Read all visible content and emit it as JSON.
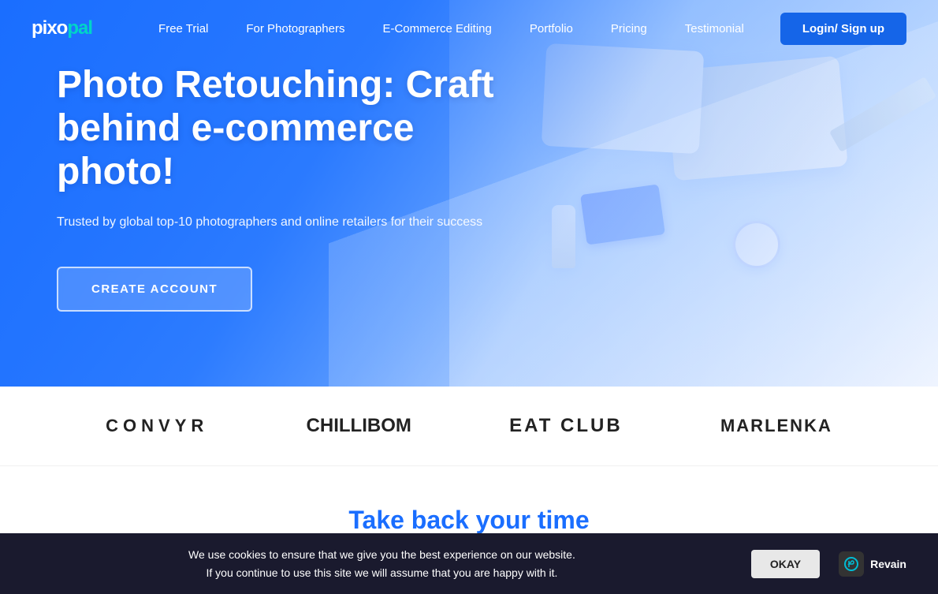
{
  "brand": {
    "name_part1": "pixo",
    "name_part2": "pal"
  },
  "nav": {
    "links": [
      {
        "label": "Free Trial",
        "id": "free-trial"
      },
      {
        "label": "For Photographers",
        "id": "for-photographers"
      },
      {
        "label": "E-Commerce Editing",
        "id": "ecommerce-editing"
      },
      {
        "label": "Portfolio",
        "id": "portfolio"
      },
      {
        "label": "Pricing",
        "id": "pricing"
      },
      {
        "label": "Testimonial",
        "id": "testimonial"
      }
    ],
    "cta_label": "Login/ Sign up"
  },
  "hero": {
    "title": "Photo Retouching: Craft behind e-commerce photo!",
    "subtitle": "Trusted by global top-10 photographers and online retailers for their success",
    "cta_label": "CREATE ACCOUNT"
  },
  "brands": [
    {
      "name": "CONVYR",
      "class": "brand-convyr"
    },
    {
      "name": "ChilliBOM",
      "class": "brand-chilli"
    },
    {
      "name": "EAT CLUB",
      "class": "brand-eat"
    },
    {
      "name": "MARLENKA",
      "class": "brand-marlenka"
    }
  ],
  "takeback": {
    "title": "Take back your time"
  },
  "cookie": {
    "line1": "We use cookies to ensure that we give you the best experience on our website.",
    "line2": "If you continue to use this site we will assume that you are happy with it.",
    "okay_label": "OKAY",
    "revain_label": "Revain"
  }
}
